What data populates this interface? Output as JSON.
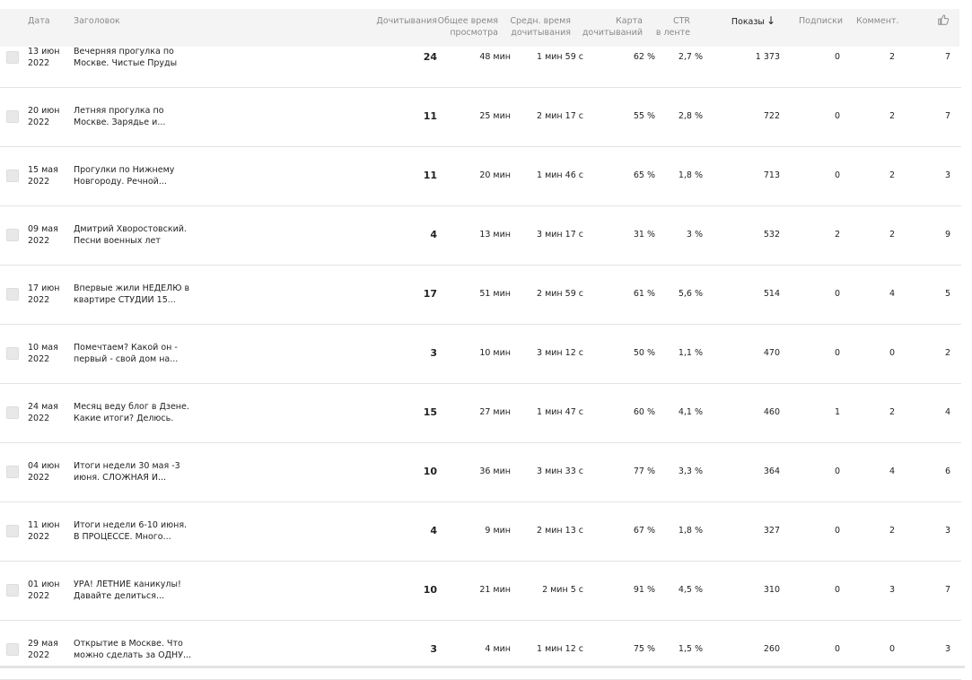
{
  "header": {
    "date": "Дата",
    "title": "Заголовок",
    "dochityvaniya": "Дочитывания",
    "total_time_1": "Общее время",
    "total_time_2": "просмотра",
    "avg_time_1": "Средн. время",
    "avg_time_2": "дочитывания",
    "card_1": "Карта",
    "card_2": "дочитываний",
    "ctr_1": "CTR",
    "ctr_2": "в ленте",
    "shows": "Показы",
    "sort_arrow": "↓",
    "subs": "Подписки",
    "comments": "Коммент.",
    "likes_icon": "thumbs-up-icon"
  },
  "rows": [
    {
      "date1": "13 июн",
      "date2": "2022",
      "title1": "Вечерняя прогулка по",
      "title2": "Москве. Чистые Пруды",
      "reads": "24",
      "total": "48 мин",
      "avg": "1 мин 59 с",
      "card": "62 %",
      "ctr": "2,7 %",
      "shows": "1 373",
      "subs": "0",
      "comments": "2",
      "likes": "7"
    },
    {
      "date1": "20 июн",
      "date2": "2022",
      "title1": "Летняя прогулка по",
      "title2": "Москве. Зарядье и...",
      "reads": "11",
      "total": "25 мин",
      "avg": "2 мин 17 с",
      "card": "55 %",
      "ctr": "2,8 %",
      "shows": "722",
      "subs": "0",
      "comments": "2",
      "likes": "7"
    },
    {
      "date1": "15 мая",
      "date2": "2022",
      "title1": "Прогулки по Нижнему",
      "title2": "Новгороду. Речной...",
      "reads": "11",
      "total": "20 мин",
      "avg": "1 мин 46 с",
      "card": "65 %",
      "ctr": "1,8 %",
      "shows": "713",
      "subs": "0",
      "comments": "2",
      "likes": "3"
    },
    {
      "date1": "09 мая",
      "date2": "2022",
      "title1": "Дмитрий Хворостовский.",
      "title2": "Песни военных лет",
      "reads": "4",
      "total": "13 мин",
      "avg": "3 мин 17 с",
      "card": "31 %",
      "ctr": "3 %",
      "shows": "532",
      "subs": "2",
      "comments": "2",
      "likes": "9"
    },
    {
      "date1": "17 июн",
      "date2": "2022",
      "title1": "Впервые жили НЕДЕЛЮ в",
      "title2": "квартире СТУДИИ 15...",
      "reads": "17",
      "total": "51 мин",
      "avg": "2 мин 59 с",
      "card": "61 %",
      "ctr": "5,6 %",
      "shows": "514",
      "subs": "0",
      "comments": "4",
      "likes": "5"
    },
    {
      "date1": "10 мая",
      "date2": "2022",
      "title1": "Помечтаем? Какой он -",
      "title2": "первый - свой дом на...",
      "reads": "3",
      "total": "10 мин",
      "avg": "3 мин 12 с",
      "card": "50 %",
      "ctr": "1,1 %",
      "shows": "470",
      "subs": "0",
      "comments": "0",
      "likes": "2"
    },
    {
      "date1": "24 мая",
      "date2": "2022",
      "title1": "Месяц веду блог в Дзене.",
      "title2": "Какие итоги? Делюсь.",
      "reads": "15",
      "total": "27 мин",
      "avg": "1 мин 47 с",
      "card": "60 %",
      "ctr": "4,1 %",
      "shows": "460",
      "subs": "1",
      "comments": "2",
      "likes": "4"
    },
    {
      "date1": "04 июн",
      "date2": "2022",
      "title1": "Итоги недели 30 мая -3",
      "title2": "июня. СЛОЖНАЯ И...",
      "reads": "10",
      "total": "36 мин",
      "avg": "3 мин 33 с",
      "card": "77 %",
      "ctr": "3,3 %",
      "shows": "364",
      "subs": "0",
      "comments": "4",
      "likes": "6"
    },
    {
      "date1": "11 июн",
      "date2": "2022",
      "title1": "Итоги недели 6-10 июня.",
      "title2": "В ПРОЦЕССЕ. Много...",
      "reads": "4",
      "total": "9 мин",
      "avg": "2 мин 13 с",
      "card": "67 %",
      "ctr": "1,8 %",
      "shows": "327",
      "subs": "0",
      "comments": "2",
      "likes": "3"
    },
    {
      "date1": "01 июн",
      "date2": "2022",
      "title1": "УРА! ЛЕТНИЕ каникулы!",
      "title2": "Давайте делиться...",
      "reads": "10",
      "total": "21 мин",
      "avg": "2 мин 5 с",
      "card": "91 %",
      "ctr": "4,5 %",
      "shows": "310",
      "subs": "0",
      "comments": "3",
      "likes": "7"
    },
    {
      "date1": "29 мая",
      "date2": "2022",
      "title1": "Открытие в Москве. Что",
      "title2": "можно сделать за ОДНУ...",
      "reads": "3",
      "total": "4 мин",
      "avg": "1 мин 12 с",
      "card": "75 %",
      "ctr": "1,5 %",
      "shows": "260",
      "subs": "0",
      "comments": "0",
      "likes": "3"
    }
  ]
}
